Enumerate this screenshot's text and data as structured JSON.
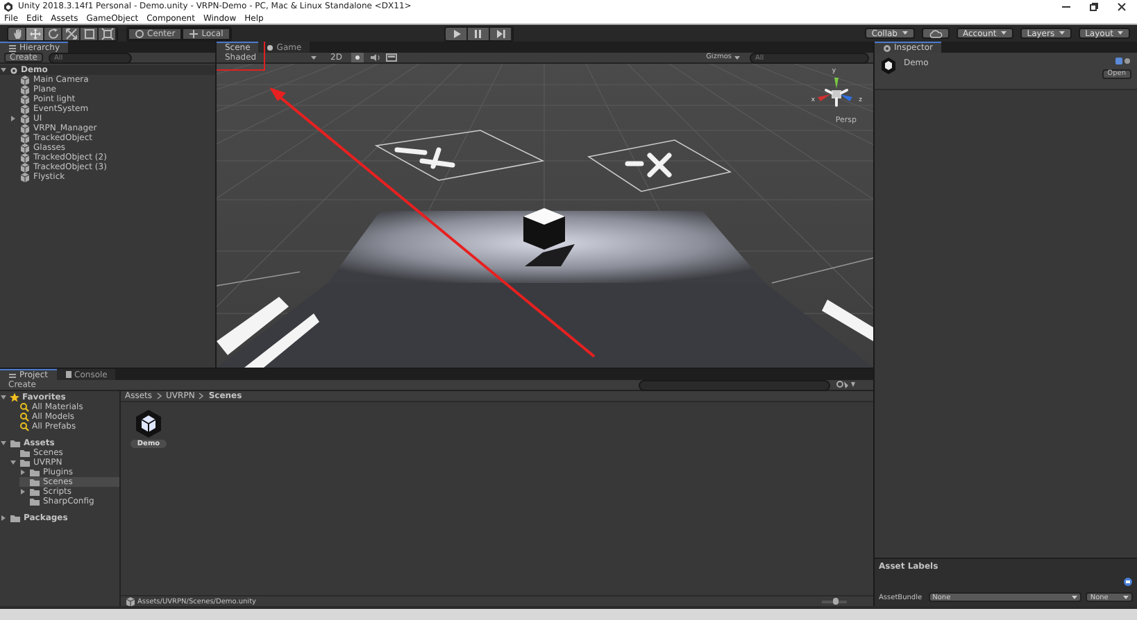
{
  "window": {
    "title": "Unity 2018.3.14f1 Personal - Demo.unity - VRPN-Demo - PC, Mac & Linux Standalone <DX11>"
  },
  "menu": [
    "File",
    "Edit",
    "Assets",
    "GameObject",
    "Component",
    "Window",
    "Help"
  ],
  "toolbar": {
    "tools": [
      {
        "kind": "hand",
        "selected": false
      },
      {
        "kind": "move",
        "selected": true
      },
      {
        "kind": "rotate",
        "selected": false
      },
      {
        "kind": "scale",
        "selected": false
      },
      {
        "kind": "rect",
        "selected": false
      },
      {
        "kind": "transform",
        "selected": false
      }
    ],
    "pivot": [
      "Center",
      "Local"
    ],
    "right": [
      {
        "kind": "dropdown",
        "label": "Collab"
      },
      {
        "kind": "cloud"
      },
      {
        "kind": "dropdown",
        "label": "Account"
      },
      {
        "kind": "dropdown",
        "label": "Layers"
      },
      {
        "kind": "dropdown",
        "label": "Layout"
      }
    ]
  },
  "hierarchy": {
    "tab": "Hierarchy",
    "create": "Create",
    "search_placeholder": "All",
    "root": {
      "label": "Demo",
      "expanded": true,
      "children": [
        {
          "label": "Main Camera"
        },
        {
          "label": "Plane"
        },
        {
          "label": "Point light"
        },
        {
          "label": "EventSystem"
        },
        {
          "label": "UI",
          "expanded": false
        },
        {
          "label": "VRPN_Manager"
        },
        {
          "label": "TrackedObject"
        },
        {
          "label": "Glasses"
        },
        {
          "label": "TrackedObject (2)"
        },
        {
          "label": "TrackedObject (3)"
        },
        {
          "label": "Flystick"
        }
      ]
    }
  },
  "scene": {
    "tabs": [
      {
        "label": "Scene",
        "selected": true
      },
      {
        "label": "Game",
        "selected": false
      }
    ],
    "shading": "Shaded",
    "mode_2d": "2D",
    "gizmos": "Gizmos",
    "search_placeholder": "All",
    "axes": [
      "y",
      "x",
      "z"
    ],
    "projection": "Persp"
  },
  "inspector": {
    "tab": "Inspector",
    "asset": "Demo",
    "open_button": "Open",
    "labels_title": "Asset Labels",
    "bundle_label": "AssetBundle",
    "bundle_values": [
      "None",
      "None"
    ]
  },
  "project": {
    "tabs": [
      {
        "label": "Project",
        "selected": true
      },
      {
        "label": "Console",
        "selected": false
      }
    ],
    "create": "Create",
    "tree": [
      {
        "label": "Favorites",
        "kind": "favorites",
        "expanded": true,
        "selected": false,
        "children": [
          {
            "label": "All Materials",
            "kind": "search",
            "selected": false
          },
          {
            "label": "All Models",
            "kind": "search",
            "selected": false
          },
          {
            "label": "All Prefabs",
            "kind": "search",
            "selected": false
          }
        ]
      },
      {
        "label": "Assets",
        "kind": "root",
        "expanded": true,
        "selected": false,
        "children": [
          {
            "label": "Scenes",
            "kind": "folder",
            "selected": false
          },
          {
            "label": "UVRPN",
            "kind": "folder",
            "expanded": true,
            "selected": false,
            "children": [
              {
                "label": "Plugins",
                "kind": "folder",
                "expanded": false,
                "selected": false
              },
              {
                "label": "Scenes",
                "kind": "folder",
                "selected": true
              },
              {
                "label": "Scripts",
                "kind": "folder",
                "expanded": false,
                "selected": false
              },
              {
                "label": "SharpConfig",
                "kind": "folder",
                "selected": false
              }
            ]
          }
        ]
      },
      {
        "label": "Packages",
        "kind": "root",
        "expanded": false,
        "selected": false
      }
    ],
    "breadcrumb": [
      "Assets",
      "UVRPN",
      "Scenes"
    ],
    "assets": [
      {
        "label": "Demo"
      }
    ],
    "footer_path": "Assets/UVRPN/Scenes/Demo.unity",
    "zoom": {
      "level": 0.55
    }
  }
}
